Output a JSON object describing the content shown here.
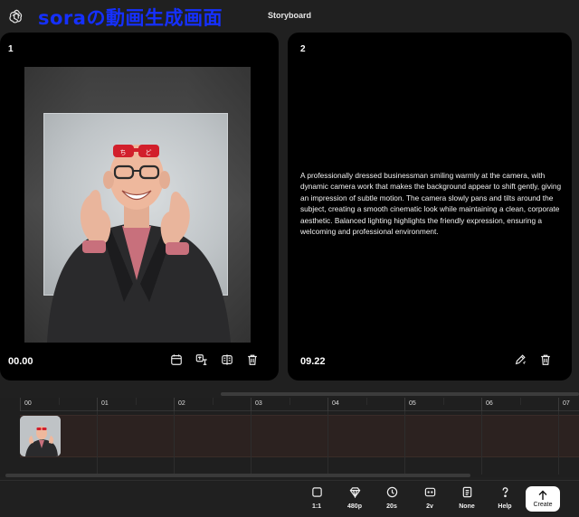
{
  "header": {
    "overlay_title": "soraの動画生成画面",
    "app_title": "Storyboard",
    "logo_icon": "openai-logo-icon"
  },
  "cards": [
    {
      "number": "1",
      "time": "00.00",
      "icons": [
        "calendar-icon",
        "translate-icon",
        "compare-icon",
        "trash-icon"
      ]
    },
    {
      "number": "2",
      "time": "09.22",
      "prompt": "A professionally dressed businessman smiling warmly at the camera, with dynamic camera work that makes the background appear to shift gently, giving an impression of subtle motion. The camera slowly pans and tilts around the subject, creating a smooth cinematic look while maintaining a clean, corporate aesthetic. Balanced lighting highlights the friendly expression, ensuring a welcoming and professional environment.",
      "icons": [
        "edit-icon",
        "trash-icon"
      ]
    }
  ],
  "timeline": {
    "ticks": [
      "00",
      "01",
      "02",
      "03",
      "04",
      "05",
      "06",
      "07"
    ]
  },
  "toolbar": {
    "aspect": "1:1",
    "resolution": "480p",
    "duration": "20s",
    "variations": "2v",
    "preset": "None",
    "help": "Help",
    "create": "Create"
  },
  "colors": {
    "accent_overlay": "#1530ff",
    "track": "#2c2220",
    "card_bg": "#000000"
  }
}
